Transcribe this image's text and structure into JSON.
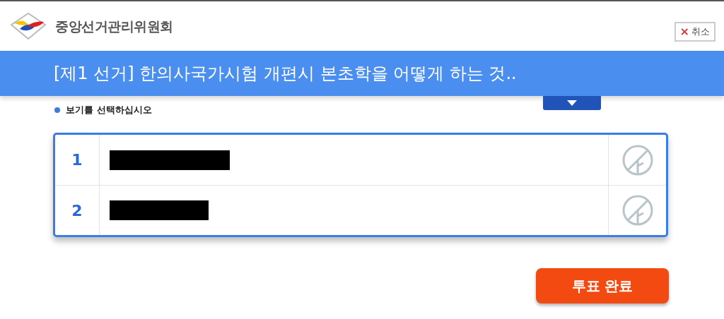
{
  "header": {
    "org_name": "중앙선거관리위원회",
    "cancel_button": {
      "icon": "×",
      "label": "취소"
    }
  },
  "title_bar": {
    "title": "[제1 선거] 한의사국가시험 개편시 본초학을 어떻게 하는 것.."
  },
  "instruction": "보기를 선택하십시오",
  "options": [
    {
      "number": "1",
      "redacted": true
    },
    {
      "number": "2",
      "redacted": true
    }
  ],
  "submit_button": "투표 완료"
}
